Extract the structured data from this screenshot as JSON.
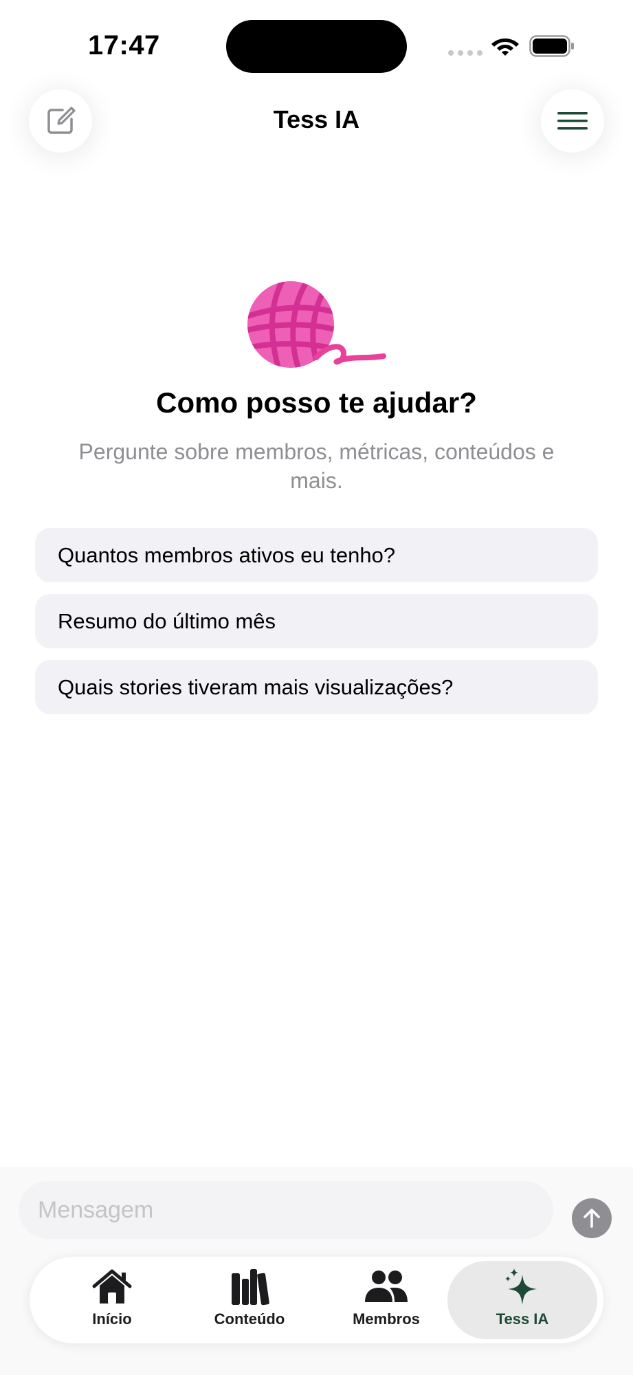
{
  "status_bar": {
    "time": "17:47"
  },
  "header": {
    "title": "Tess IA"
  },
  "hero": {
    "title": "Como posso te ajudar?",
    "subtitle": "Pergunte sobre membros, métricas, conteúdos e mais."
  },
  "suggestions": [
    "Quantos membros ativos eu tenho?",
    "Resumo do último mês",
    "Quais stories tiveram mais visualizações?"
  ],
  "composer": {
    "placeholder": "Mensagem"
  },
  "tabs": [
    {
      "label": "Início",
      "icon": "house-icon"
    },
    {
      "label": "Conteúdo",
      "icon": "books-icon"
    },
    {
      "label": "Membros",
      "icon": "people-icon"
    },
    {
      "label": "Tess IA",
      "icon": "sparkles-icon",
      "selected": true
    }
  ],
  "colors": {
    "accent": "#1d4a36",
    "yarn": "#e8419a",
    "suggestion_bg": "#f2f2f6"
  }
}
